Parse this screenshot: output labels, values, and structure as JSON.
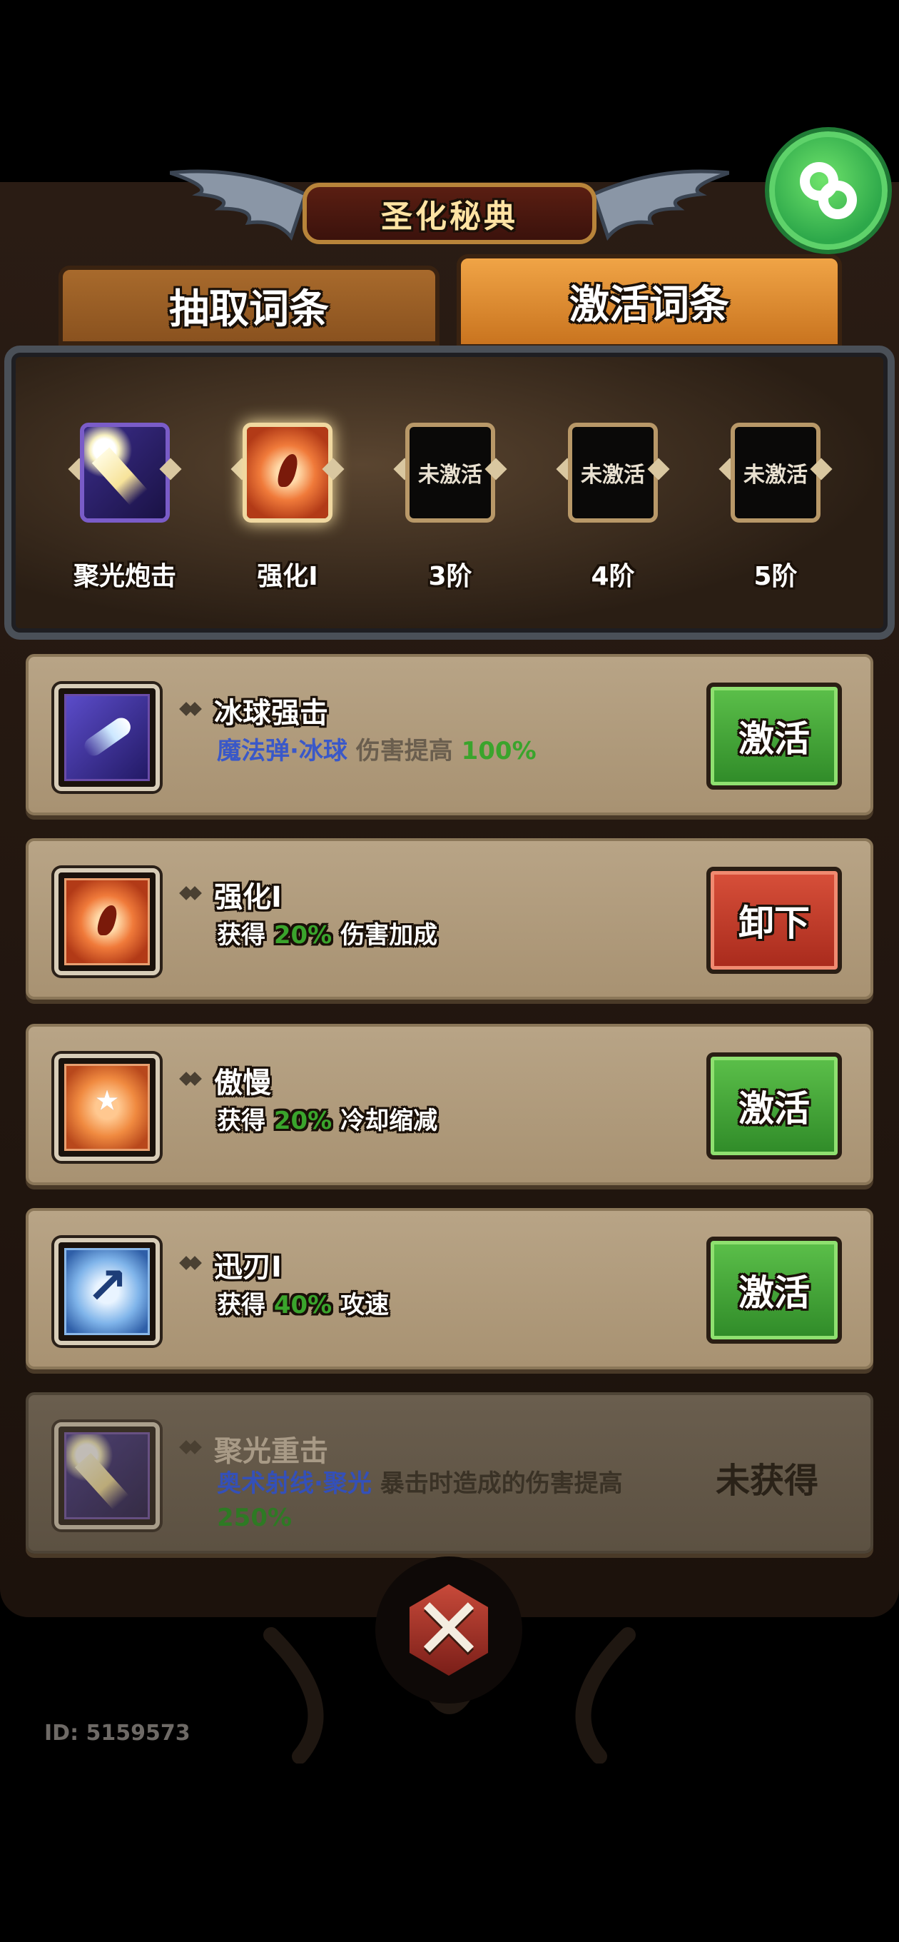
{
  "title": "圣化秘典",
  "tabs": [
    {
      "label": "抽取词条",
      "active": false
    },
    {
      "label": "激活词条",
      "active": true
    }
  ],
  "slots": [
    {
      "label": "聚光炮击",
      "icon": "light-beam-icon",
      "state": "filled"
    },
    {
      "label": "强化I",
      "icon": "fire-burst-icon",
      "state": "selected"
    },
    {
      "label": "3阶",
      "empty_text": "未激活",
      "state": "empty"
    },
    {
      "label": "4阶",
      "empty_text": "未激活",
      "state": "empty"
    },
    {
      "label": "5阶",
      "empty_text": "未激活",
      "state": "empty"
    }
  ],
  "entries": [
    {
      "name": "冰球强击",
      "icon": "ice-comet-icon",
      "desc": {
        "skill": "魔法弹·冰球",
        "text": " 伤害提高 ",
        "value": "100%"
      },
      "action": "激活",
      "action_type": "activate"
    },
    {
      "name": "强化I",
      "icon": "fire-burst-icon",
      "desc": {
        "prefix": "获得 ",
        "value": "20%",
        "text": " 伤害加成"
      },
      "action": "卸下",
      "action_type": "unequip"
    },
    {
      "name": "傲慢",
      "icon": "star-shield-icon",
      "desc": {
        "prefix": "获得 ",
        "value": "20%",
        "text": " 冷却缩减"
      },
      "action": "激活",
      "action_type": "activate"
    },
    {
      "name": "迅刃I",
      "icon": "blue-arrow-icon",
      "desc": {
        "prefix": "获得 ",
        "value": "40%",
        "text": " 攻速"
      },
      "action": "激活",
      "action_type": "activate"
    },
    {
      "name": "聚光重击",
      "icon": "light-beam-icon",
      "desc": {
        "skill": "奥术射线·聚光",
        "text": " 暴击时造成的伤害提高",
        "value": "250%"
      },
      "status": "未获得"
    }
  ],
  "user_id": "ID: 5159573",
  "colors": {
    "accent_green": "#3aa42c",
    "skill_blue": "#3a58c8",
    "unequip_red": "#c23a28"
  }
}
